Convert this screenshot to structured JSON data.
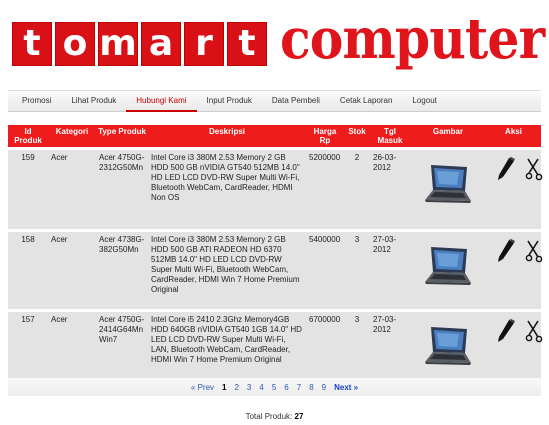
{
  "logo": {
    "letters": [
      "t",
      "o",
      "m",
      "a",
      "r",
      "t"
    ],
    "word": "computer"
  },
  "nav": {
    "items": [
      "Promosi",
      "Lihat Produk",
      "Hubungi Kami",
      "Input Produk",
      "Data Pembeli",
      "Cetak Laporan",
      "Logout"
    ],
    "active": "Hubungi Kami"
  },
  "table": {
    "headers": [
      "Id Produk",
      "Kategori",
      "Type Produk",
      "Deskripsi",
      "Harga Rp",
      "Stok",
      "Tgl Masuk",
      "Gambar",
      "Aksi"
    ],
    "rows": [
      {
        "id": "159",
        "kategori": "Acer",
        "type": "Acer 4750G-2312G50Mn",
        "deskripsi": "Intel Core i3 380M 2.53 Memory 2 GB HDD 500 GB nVIDIA GT540 512MB 14.0\" HD LED LCD DVD-RW Super Multi Wi-Fi, Bluetooth WebCam, CardReader, HDMI Non OS",
        "harga": "5200000",
        "stok": "2",
        "tgl": "26-03-2012"
      },
      {
        "id": "158",
        "kategori": "Acer",
        "type": "Acer 4738G-382G50Mn",
        "deskripsi": "Intel Core i3 380M 2.53 Memory 2 GB HDD 500 GB ATI RADEON HD 6370 512MB 14.0\" HD LED LCD DVD-RW Super Multi Wi-Fi, Bluetooth WebCam, CardReader, HDMI Win 7 Home Premium Original",
        "harga": "5400000",
        "stok": "3",
        "tgl": "27-03-2012"
      },
      {
        "id": "157",
        "kategori": "Acer",
        "type": "Acer 4750G-2414G64Mn Win7",
        "deskripsi": "Intel Core i5 2410 2.3Ghz Memory4GB HDD 640GB nVIDIA GT540 1GB 14.0\" HD LED LCD DVD-RW Super Multi Wi-Fi, LAN, Bluetooth WebCam, CardReader, HDMI Win 7 Home Premium Original",
        "harga": "6700000",
        "stok": "3",
        "tgl": "27-03-2012"
      }
    ]
  },
  "pager": {
    "prev": "« Prev",
    "pages": [
      "1",
      "2",
      "3",
      "4",
      "5",
      "6",
      "7",
      "8",
      "9"
    ],
    "current": "1",
    "next": "Next »"
  },
  "footer": {
    "total_label": "Total Produk:",
    "total_value": "27"
  },
  "icons": {
    "edit": "pencil-icon",
    "delete": "scissors-icon",
    "image": "laptop-image"
  },
  "colors": {
    "brand_red": "#ee1c1c",
    "row_bg": "#e3e3e3",
    "link_blue": "#2a5db0"
  }
}
